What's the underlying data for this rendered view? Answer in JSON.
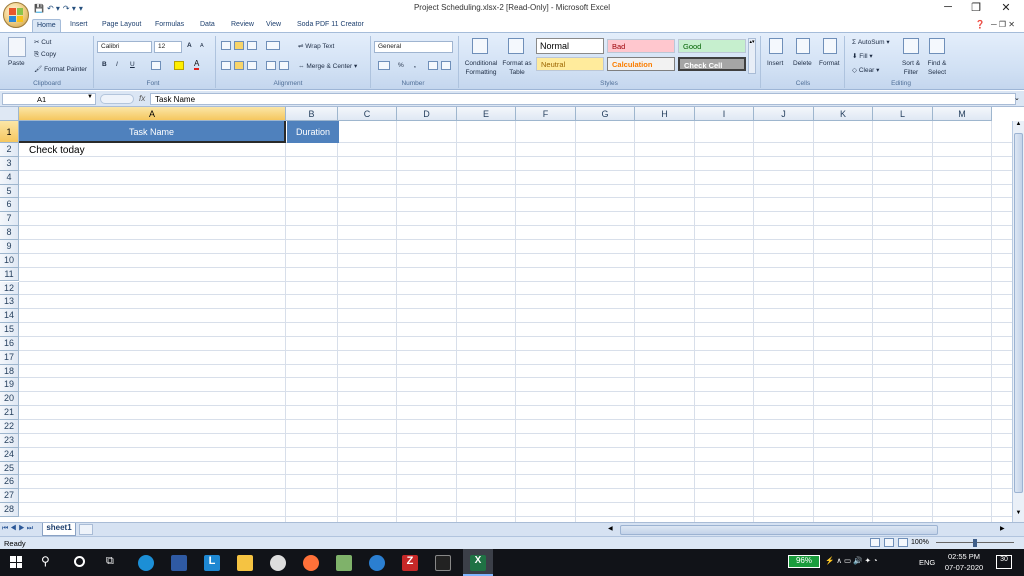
{
  "window": {
    "title": "Project Scheduling.xlsx-2  [Read-Only]  -  Microsoft Excel",
    "minimize_icon": "minimize-icon",
    "restore_icon": "restore-icon",
    "close_icon": "close-icon"
  },
  "tabs": [
    "Home",
    "Insert",
    "Page Layout",
    "Formulas",
    "Data",
    "Review",
    "View",
    "Soda PDF 11 Creator"
  ],
  "ribbon": {
    "clipboard": {
      "paste": "Paste",
      "cut": "Cut",
      "copy": "Copy",
      "format_painter": "Format Painter",
      "label": "Clipboard"
    },
    "font": {
      "name": "Calibri",
      "size": "12",
      "label": "Font",
      "bold": "B",
      "italic": "I",
      "underline": "U",
      "grow": "A",
      "shrink": "A"
    },
    "alignment": {
      "wrap": "Wrap Text",
      "merge": "Merge & Center",
      "label": "Alignment"
    },
    "number": {
      "format": "General",
      "percent": "%",
      "comma": ",",
      "label": "Number"
    },
    "styles": {
      "conditional": "Conditional Formatting",
      "format_table": "Format as Table",
      "normal": "Normal",
      "bad": "Bad",
      "good": "Good",
      "neutral": "Neutral",
      "calculation": "Calculation",
      "check_cell": "Check Cell",
      "label": "Styles"
    },
    "cells": {
      "insert": "Insert",
      "delete": "Delete",
      "format": "Format",
      "label": "Cells"
    },
    "editing": {
      "autosum": "AutoSum",
      "fill": "Fill",
      "clear": "Clear",
      "sort": "Sort & Filter",
      "find": "Find & Select",
      "label": "Editing"
    }
  },
  "formula_bar": {
    "name_box": "A1",
    "fx": "fx",
    "formula": "Task Name"
  },
  "columns": [
    "A",
    "B",
    "C",
    "D",
    "E",
    "F",
    "G",
    "H",
    "I",
    "J",
    "K",
    "L",
    "M"
  ],
  "rows": [
    "1",
    "2",
    "3",
    "4",
    "5",
    "6",
    "7",
    "8",
    "9",
    "10",
    "11",
    "12",
    "13",
    "14",
    "15",
    "16",
    "17",
    "18",
    "19",
    "20",
    "21",
    "22",
    "23",
    "24",
    "25",
    "26",
    "27",
    "28"
  ],
  "cells": {
    "a1": "Task Name",
    "b1": "Duration",
    "a2": "Check today"
  },
  "colors": {
    "header_fill": "#4f81bd",
    "header_text": "#ffffff"
  },
  "sheet_tabs": [
    "sheet1"
  ],
  "status": {
    "ready": "Ready",
    "zoom": "100%"
  },
  "taskbar": {
    "battery": "96%",
    "lang": "ENG",
    "time": "02:55 PM",
    "date": "07-07-2020",
    "notif": "30"
  }
}
